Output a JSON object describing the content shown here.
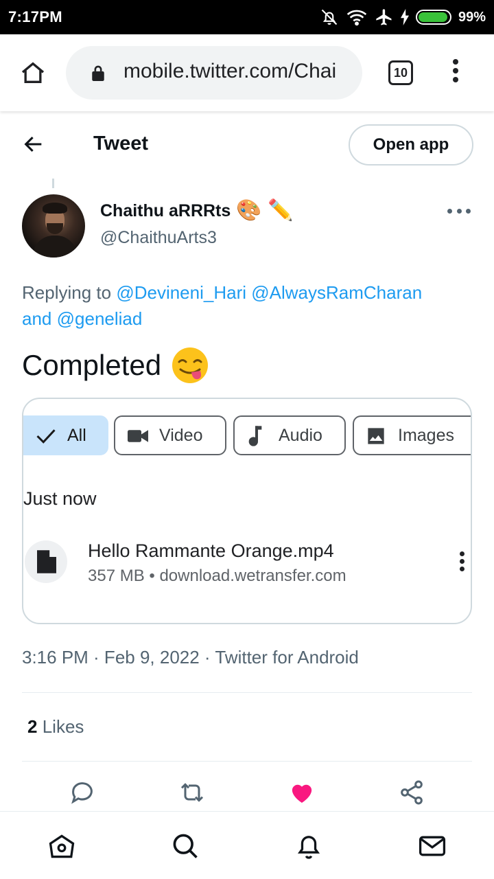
{
  "status_bar": {
    "time": "7:17PM",
    "battery_percent": "99%",
    "battery_level": 0.99
  },
  "browser": {
    "url": "mobile.twitter.com/Chai",
    "tab_count": "10"
  },
  "header": {
    "title": "Tweet",
    "open_app_label": "Open app"
  },
  "tweet": {
    "author_name": "Chaithu aRRRts",
    "author_emojis": "🎨 ✏️",
    "author_handle": "@ChaithuArts3",
    "replying_prefix": "Replying to",
    "mentions": [
      "@Devineni_Hari",
      "@AlwaysRamCharan"
    ],
    "replying_and": "and",
    "mention_last": "@geneliad",
    "text": "Completed",
    "timestamp": "3:16 PM · Feb 9, 2022 · Twitter for Android",
    "likes_count": "2",
    "likes_label": "Likes"
  },
  "media": {
    "filter_chips": [
      {
        "label": "All",
        "selected": true
      },
      {
        "label": "Video",
        "selected": false
      },
      {
        "label": "Audio",
        "selected": false
      },
      {
        "label": "Images",
        "selected": false
      }
    ],
    "date_group": "Just now",
    "file_name": "Hello Rammante Orange.mp4",
    "file_meta": "357 MB • download.wetransfer.com"
  },
  "icons": {
    "back": "arrow-left-icon",
    "home": "home-icon",
    "lock": "lock-icon",
    "more": "more-horizontal-icon",
    "reply": "comment-icon",
    "retweet": "retweet-icon",
    "like": "heart-icon",
    "share": "share-icon",
    "nav_home": "home-icon",
    "nav_search": "search-icon",
    "nav_notifications": "bell-icon",
    "nav_messages": "mail-icon"
  },
  "colors": {
    "accent": "#1d9bf0",
    "like": "#f91880",
    "chip_selected": "#c9e4fb",
    "battery": "#3ac23a"
  }
}
